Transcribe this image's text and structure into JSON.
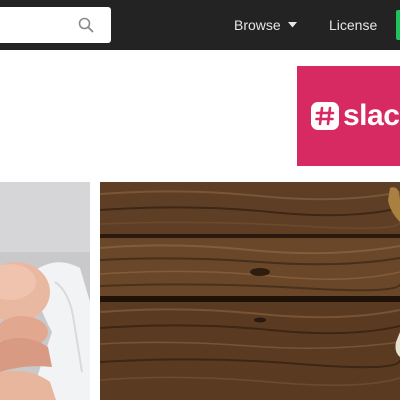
{
  "header": {
    "search": {
      "placeholder": "",
      "value": "",
      "icon": "search-icon"
    },
    "nav": {
      "browse_label": "Browse",
      "browse_icon": "caret-down-icon",
      "license_label": "License"
    },
    "colors": {
      "bar": "#232323",
      "nav_text": "#e6e6e6",
      "cta": "#1ec35b"
    }
  },
  "ad": {
    "brand_text": "slack",
    "logo_icon": "slack-hash-icon",
    "background": "#d72a63"
  },
  "photos": [
    {
      "subject": "sleeping baby"
    },
    {
      "subject": "dark wood planks"
    }
  ]
}
